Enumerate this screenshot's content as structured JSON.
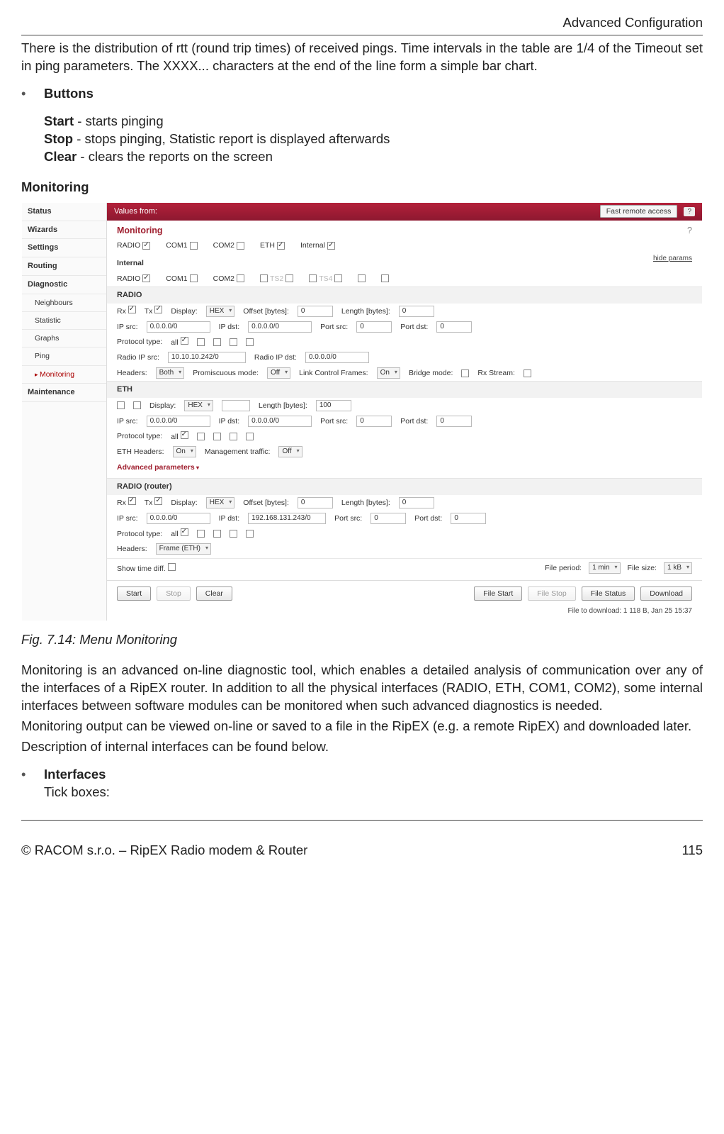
{
  "header": {
    "right": "Advanced Configuration"
  },
  "intro": {
    "rtt": "There is the distribution of rtt (round trip times) of received pings. Time intervals in the table are 1/4 of the Timeout set in ping parameters. The XXXX... characters at the end of the line form a simple bar chart.",
    "buttons_label": "Buttons",
    "start_b": "Start",
    "start_t": " - starts pinging",
    "stop_b": "Stop",
    "stop_t": " - stops pinging, Statistic report is displayed afterwards",
    "clear_b": "Clear",
    "clear_t": " - clears the reports on the screen"
  },
  "monitoring_heading": "Monitoring",
  "sidebar": {
    "items": [
      "Status",
      "Wizards",
      "Settings",
      "Routing",
      "Diagnostic"
    ],
    "diag_sub": [
      "Neighbours",
      "Statistic",
      "Graphs",
      "Ping",
      "Monitoring"
    ],
    "last": "Maintenance"
  },
  "topbar": {
    "values_from": "Values from:",
    "remote": "Fast remote access",
    "q": "?"
  },
  "panel": {
    "title": "Monitoring",
    "ifaces": {
      "radio": "RADIO",
      "com1": "COM1",
      "com2": "COM2",
      "eth": "ETH",
      "internal": "Internal",
      "internal_label": "Internal",
      "ts2": "TS2",
      "ts4": "TS4",
      "hide": "hide params"
    },
    "radio": {
      "title": "RADIO",
      "rx": "Rx",
      "tx": "Tx",
      "display": "Display:",
      "display_v": "HEX",
      "offset": "Offset [bytes]:",
      "offset_v": "0",
      "length": "Length [bytes]:",
      "length_v": "0",
      "ipsrc": "IP src:",
      "ipsrc_v": "0.0.0.0/0",
      "ipdst": "IP dst:",
      "ipdst_v": "0.0.0.0/0",
      "portsrc": "Port src:",
      "portsrc_v": "0",
      "portdst": "Port dst:",
      "portdst_v": "0",
      "proto": "Protocol type:",
      "proto_v": "all",
      "ripsrc": "Radio IP src:",
      "ripsrc_v": "10.10.10.242/0",
      "ripdst": "Radio IP dst:",
      "ripdst_v": "0.0.0.0/0",
      "headers": "Headers:",
      "headers_v": "Both",
      "prom": "Promiscuous mode:",
      "prom_v": "Off",
      "lcf": "Link Control Frames:",
      "lcf_v": "On",
      "bridge": "Bridge mode:",
      "rxs": "Rx Stream:"
    },
    "eth": {
      "title": "ETH",
      "display": "Display:",
      "display_v": "HEX",
      "length": "Length [bytes]:",
      "length_v": "100",
      "ipsrc": "IP src:",
      "ipsrc_v": "0.0.0.0/0",
      "ipdst": "IP dst:",
      "ipdst_v": "0.0.0.0/0",
      "portsrc": "Port src:",
      "portsrc_v": "0",
      "portdst": "Port dst:",
      "portdst_v": "0",
      "proto": "Protocol type:",
      "proto_v": "all",
      "ehdr": "ETH Headers:",
      "ehdr_v": "On",
      "mgmt": "Management traffic:",
      "mgmt_v": "Off",
      "adv": "Advanced parameters"
    },
    "rr": {
      "title": "RADIO (router)",
      "rx": "Rx",
      "tx": "Tx",
      "display": "Display:",
      "display_v": "HEX",
      "offset": "Offset [bytes]:",
      "offset_v": "0",
      "length": "Length [bytes]:",
      "length_v": "0",
      "ipsrc": "IP src:",
      "ipsrc_v": "0.0.0.0/0",
      "ipdst": "IP dst:",
      "ipdst_v": "192.168.131.243/0",
      "portsrc": "Port src:",
      "portsrc_v": "0",
      "portdst": "Port dst:",
      "portdst_v": "0",
      "proto": "Protocol type:",
      "proto_v": "all",
      "headers": "Headers:",
      "headers_v": "Frame (ETH)"
    },
    "footer": {
      "show": "Show time diff.",
      "fperiod": "File period:",
      "fperiod_v": "1 min",
      "fsize": "File size:",
      "fsize_v": "1 kB"
    },
    "buttons": {
      "start": "Start",
      "stop": "Stop",
      "clear": "Clear",
      "fstart": "File Start",
      "fstop": "File Stop",
      "fstatus": "File Status",
      "download": "Download"
    },
    "fileinfo": "File to download: 1 118 B, Jan 25 15:37"
  },
  "caption": "Fig. 7.14: Menu Monitoring",
  "body": {
    "p1": "Monitoring is an advanced on-line diagnostic tool, which enables a detailed analysis of communication over any of the interfaces of a RipEX router. In addition to all the physical interfaces (RADIO, ETH, COM1, COM2), some internal interfaces between software modules can be monitored when such advanced diagnostics is needed.",
    "p2": "Monitoring output can be viewed on-line or saved to a file in the RipEX (e.g. a remote RipEX) and downloaded later.",
    "p3": "Description of internal interfaces can be found below.",
    "iface_b": "Interfaces",
    "iface_t": "Tick boxes:"
  },
  "footer": {
    "left": "© RACOM s.r.o. – RipEX Radio modem & Router",
    "right": "115"
  }
}
